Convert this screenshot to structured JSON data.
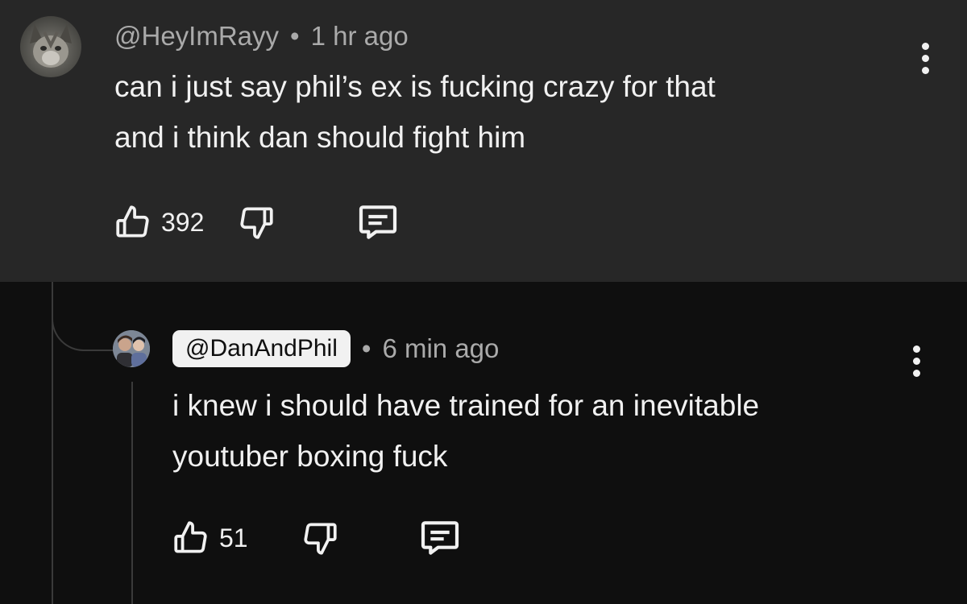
{
  "comments": [
    {
      "author": "@HeyImRayy",
      "separator": "•",
      "time": "1 hr ago",
      "lines": [
        "can i just say phil’s ex is fucking crazy for that",
        "and i think dan should fight him"
      ],
      "like_count": "392",
      "avatar": "cat-avatar"
    },
    {
      "author": "@DanAndPhil",
      "separator": "•",
      "time": "6 min ago",
      "lines": [
        "i knew i should have trained for an inevitable",
        "youtuber boxing fuck"
      ],
      "like_count": "51",
      "avatar": "dan-and-phil-avatar"
    }
  ],
  "icons": {
    "like": "thumbs-up-icon",
    "dislike": "thumbs-down-icon",
    "reply": "reply-icon",
    "more": "more-vertical-icon"
  },
  "colors": {
    "top_comment_background": "#272727",
    "reply_background": "#0f0f0f",
    "primary_text": "#f1f1f1",
    "secondary_text": "#aaaaaa",
    "creator_chip": "#f1f1f1"
  }
}
